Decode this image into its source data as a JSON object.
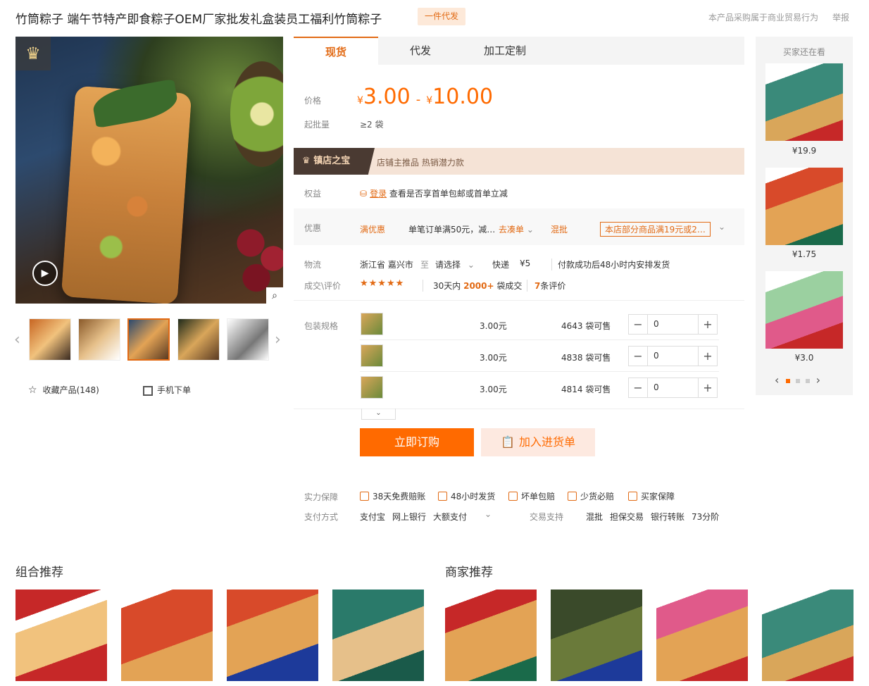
{
  "header": {
    "title": "竹筒粽子 端午节特产即食粽子OEM厂家批发礼盒装员工福利竹筒粽子",
    "badge": "一件代发",
    "trade_note": "本产品采购属于商业贸易行为",
    "report": "举报"
  },
  "gallery": {
    "favorite_label": "收藏产品(148)",
    "mobile_label": "手机下单"
  },
  "tabs": [
    {
      "label": "现货"
    },
    {
      "label": "代发"
    },
    {
      "label": "加工定制"
    }
  ],
  "price": {
    "label": "价格",
    "currency": "¥",
    "min": "3.00",
    "max": "10.00",
    "moq_label": "起批量",
    "moq_value": "≥2 袋"
  },
  "treasure": {
    "tag": "镇店之宝",
    "text": "店铺主推品  热销潜力款"
  },
  "rights": {
    "label": "权益",
    "login": "登录",
    "text": "查看是否享首单包邮或首单立减"
  },
  "offers": {
    "label": "优惠",
    "type1": "满优惠",
    "desc1": "单笔订单满50元，减…",
    "action1": "去凑单",
    "type2": "混批",
    "desc2": "本店部分商品满19元或2…"
  },
  "logistics": {
    "label": "物流",
    "from": "浙江省 嘉兴市",
    "to_word": "至",
    "select": "请选择",
    "express": "快递",
    "fee": "¥5",
    "note": "付款成功后48小时内安排发货"
  },
  "deals": {
    "label": "成交\\评价",
    "stars": "★★★★★",
    "days": "30天内",
    "count": "2000+",
    "unit": "袋成交",
    "reviews_num": "7",
    "reviews_unit": "条评价"
  },
  "specs": {
    "label": "包装规格",
    "rows": [
      {
        "price": "3.00元",
        "stock": "4643 袋可售",
        "qty": "0"
      },
      {
        "price": "3.00元",
        "stock": "4838 袋可售",
        "qty": "0"
      },
      {
        "price": "3.00元",
        "stock": "4814 袋可售",
        "qty": "0"
      }
    ],
    "minus": "−",
    "plus": "+",
    "expand": "⌄"
  },
  "actions": {
    "buy": "立即订购",
    "cart": "加入进货单"
  },
  "guarantee": {
    "label": "实力保障",
    "items": [
      "38天免费赔账",
      "48小时发货",
      "坏单包赔",
      "少货必赔",
      "买家保障"
    ]
  },
  "payment": {
    "label": "支付方式",
    "items": [
      "支付宝",
      "网上银行",
      "大额支付"
    ],
    "trade_label": "交易支持",
    "trade_items": [
      "混批",
      "担保交易",
      "银行转账",
      "73分阶"
    ]
  },
  "recommend": {
    "title": "买家还在看",
    "items": [
      {
        "price": "¥19.9"
      },
      {
        "price": "¥1.75"
      },
      {
        "price": "¥3.0"
      }
    ]
  },
  "bottom": {
    "combo_title": "组合推荐",
    "merchant_title": "商家推荐"
  },
  "colors": {
    "accent": "#ff6a00",
    "accent_dark": "#e26a14"
  }
}
